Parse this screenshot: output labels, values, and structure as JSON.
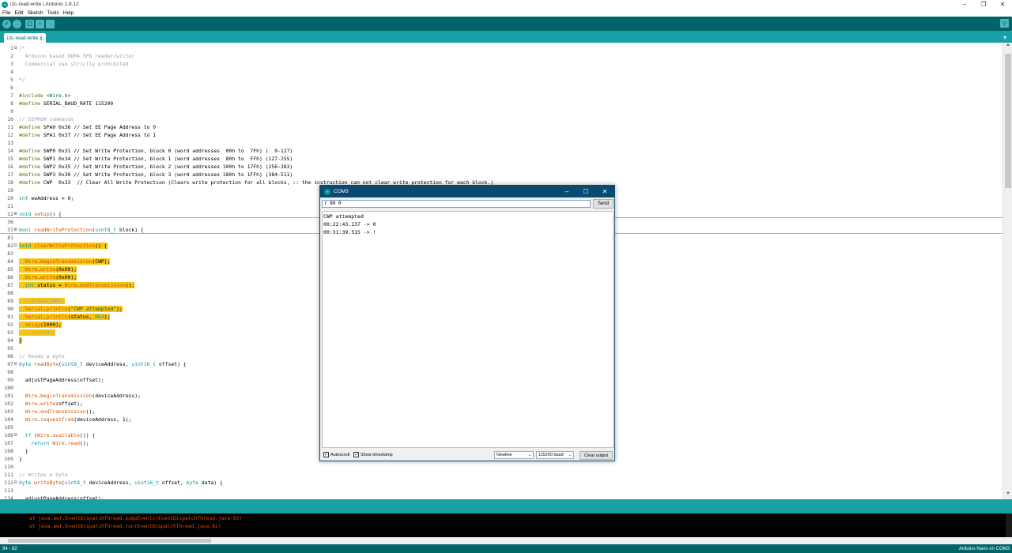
{
  "window": {
    "title": "i2c-read-write | Arduino 1.8.12",
    "minimize_icon": "minimize-icon",
    "maximize_icon": "maximize-icon",
    "close_icon": "close-icon"
  },
  "menu": [
    "File",
    "Edit",
    "Sketch",
    "Tools",
    "Help"
  ],
  "toolbar": {
    "verify_icon": "✓",
    "upload_icon": "→",
    "new_icon": "▢",
    "open_icon": "↑",
    "save_icon": "↓",
    "serial_monitor_icon": "⚲"
  },
  "tab": {
    "label": "i2c-read-write §",
    "menu_icon": "▾"
  },
  "code": {
    "lines": [
      {
        "n": "1",
        "fold": "⊟",
        "parts": [
          [
            "c-comment",
            "/*"
          ]
        ]
      },
      {
        "n": "2",
        "parts": [
          [
            "c-comment",
            "  Arduino based DDR4 SPD reader/writer"
          ]
        ]
      },
      {
        "n": "3",
        "parts": [
          [
            "c-comment",
            "  Commercial use strictly prohibited"
          ]
        ]
      },
      {
        "n": "4",
        "parts": [
          [
            "",
            ""
          ]
        ]
      },
      {
        "n": "5",
        "parts": [
          [
            "c-comment",
            "*/"
          ]
        ]
      },
      {
        "n": "6",
        "parts": [
          [
            "",
            ""
          ]
        ]
      },
      {
        "n": "7",
        "parts": [
          [
            "c-pp",
            "#include "
          ],
          [
            "c-str",
            "<Wire.h>"
          ]
        ]
      },
      {
        "n": "8",
        "parts": [
          [
            "c-pp",
            "#define "
          ],
          [
            "",
            "SERIAL_BAUD_RATE 115200"
          ]
        ]
      },
      {
        "n": "9",
        "parts": [
          [
            "",
            ""
          ]
        ]
      },
      {
        "n": "10",
        "parts": [
          [
            "c-comment",
            "// EEPROM commands"
          ]
        ]
      },
      {
        "n": "11",
        "parts": [
          [
            "c-pp",
            "#define "
          ],
          [
            "",
            "SPA0 0x36 // Set EE Page Address to 0"
          ]
        ]
      },
      {
        "n": "12",
        "parts": [
          [
            "c-pp",
            "#define "
          ],
          [
            "",
            "SPA1 0x37 // Set EE Page Address to 1"
          ]
        ]
      },
      {
        "n": "13",
        "parts": [
          [
            "",
            ""
          ]
        ]
      },
      {
        "n": "14",
        "parts": [
          [
            "c-pp",
            "#define "
          ],
          [
            "",
            "SWP0 0x31 // Set Write Protection, block 0 (word addresses  00h to  7Fh) (  0-127)"
          ]
        ]
      },
      {
        "n": "15",
        "parts": [
          [
            "c-pp",
            "#define "
          ],
          [
            "",
            "SWP1 0x34 // Set Write Protection, block 1 (word addresses  80h to  FFh) (127-255)"
          ]
        ]
      },
      {
        "n": "16",
        "parts": [
          [
            "c-pp",
            "#define "
          ],
          [
            "",
            "SWP2 0x35 // Set Write Protection, block 2 (word addresses 100h to 17Fh) (256-383)"
          ]
        ]
      },
      {
        "n": "17",
        "parts": [
          [
            "c-pp",
            "#define "
          ],
          [
            "",
            "SWP3 0x30 // Set Write Protection, block 3 (word addresses 180h to 1FFh) (384-511)"
          ]
        ]
      },
      {
        "n": "18",
        "parts": [
          [
            "c-pp",
            "#define "
          ],
          [
            "",
            "CWP  0x33  // Clear All Write Protection (Clears write protection for all blocks, :: the instruction can not clear write protection for each block.)"
          ]
        ]
      },
      {
        "n": "19",
        "parts": [
          [
            "",
            ""
          ]
        ]
      },
      {
        "n": "20",
        "parts": [
          [
            "c-kw",
            "int"
          ],
          [
            "",
            " eeAddress = 0;"
          ]
        ]
      },
      {
        "n": "21",
        "parts": [
          [
            "",
            ""
          ]
        ]
      },
      {
        "n": "22",
        "fold": "⊞",
        "parts": [
          [
            "c-kw",
            "void"
          ],
          [
            "",
            " "
          ],
          [
            "c-type",
            "setup"
          ],
          [
            "",
            "() {"
          ]
        ]
      },
      {
        "n": "36",
        "parts": [
          [
            "",
            ""
          ]
        ]
      },
      {
        "n": "37",
        "fold": "⊞",
        "parts": [
          [
            "c-kw",
            "bool"
          ],
          [
            "",
            " "
          ],
          [
            "c-type",
            "readWriteProtection"
          ],
          [
            "",
            "("
          ],
          [
            "c-kw",
            "uint8_t"
          ],
          [
            "",
            " block) {"
          ]
        ]
      },
      {
        "n": "81",
        "parts": [
          [
            "",
            ""
          ]
        ]
      },
      {
        "n": "82",
        "fold": "⊟",
        "hl": true,
        "parts": [
          [
            "c-kw",
            "void"
          ],
          [
            "",
            " "
          ],
          [
            "c-type",
            "clearWriteProtection"
          ],
          [
            "",
            "() {"
          ]
        ]
      },
      {
        "n": "83",
        "parts": [
          [
            "",
            ""
          ]
        ]
      },
      {
        "n": "84",
        "hl": true,
        "parts": [
          [
            "",
            "  "
          ],
          [
            "c-type",
            "Wire"
          ],
          [
            "",
            "."
          ],
          [
            "c-type",
            "beginTransmission"
          ],
          [
            "",
            "(CWP);"
          ]
        ]
      },
      {
        "n": "85",
        "hl": true,
        "parts": [
          [
            "",
            "  "
          ],
          [
            "c-type",
            "Wire"
          ],
          [
            "",
            "."
          ],
          [
            "c-type",
            "write"
          ],
          [
            "",
            "(0x00);"
          ]
        ]
      },
      {
        "n": "86",
        "hl": true,
        "parts": [
          [
            "",
            "  "
          ],
          [
            "c-type",
            "Wire"
          ],
          [
            "",
            "."
          ],
          [
            "c-type",
            "write"
          ],
          [
            "",
            "(0x00);"
          ]
        ]
      },
      {
        "n": "87",
        "hl": true,
        "parts": [
          [
            "",
            "  "
          ],
          [
            "c-kw",
            "int"
          ],
          [
            "",
            " status = "
          ],
          [
            "c-type",
            "Wire"
          ],
          [
            "",
            "."
          ],
          [
            "c-type",
            "endTransmission"
          ],
          [
            "",
            "();"
          ]
        ]
      },
      {
        "n": "88",
        "parts": [
          [
            "",
            ""
          ]
        ]
      },
      {
        "n": "89",
        "hl": true,
        "parts": [
          [
            "",
            "  "
          ],
          [
            "c-comment",
            "//probe(CWP);"
          ]
        ]
      },
      {
        "n": "90",
        "hl": true,
        "parts": [
          [
            "",
            "  "
          ],
          [
            "c-type",
            "Serial"
          ],
          [
            "",
            "."
          ],
          [
            "c-type",
            "println"
          ],
          [
            "",
            "("
          ],
          [
            "c-str",
            "\"CWP attempted\""
          ],
          [
            "",
            ");"
          ]
        ]
      },
      {
        "n": "91",
        "hl": true,
        "parts": [
          [
            "",
            "  "
          ],
          [
            "c-type",
            "Serial"
          ],
          [
            "",
            "."
          ],
          [
            "c-type",
            "println"
          ],
          [
            "",
            "(status, "
          ],
          [
            "c-kw",
            "HEX"
          ],
          [
            "",
            ");"
          ]
        ]
      },
      {
        "n": "92",
        "hl": true,
        "parts": [
          [
            "",
            "  "
          ],
          [
            "c-type",
            "delay"
          ],
          [
            "",
            "(1000);"
          ]
        ]
      },
      {
        "n": "93",
        "hl": true,
        "parts": [
          [
            "",
            "  "
          ],
          [
            "c-comment",
            "//exit(0);"
          ]
        ]
      },
      {
        "n": "94",
        "hl": true,
        "parts": [
          [
            "",
            "}"
          ]
        ]
      },
      {
        "n": "95",
        "parts": [
          [
            "",
            ""
          ]
        ]
      },
      {
        "n": "96",
        "parts": [
          [
            "c-comment",
            "// Reads a byte"
          ]
        ]
      },
      {
        "n": "97",
        "fold": "⊟",
        "parts": [
          [
            "c-kw",
            "byte"
          ],
          [
            "",
            " "
          ],
          [
            "c-type",
            "readByte"
          ],
          [
            "",
            "("
          ],
          [
            "c-kw",
            "uint8_t"
          ],
          [
            "",
            " deviceAddress, "
          ],
          [
            "c-kw",
            "uint16_t"
          ],
          [
            "",
            " offset) {"
          ]
        ]
      },
      {
        "n": "98",
        "parts": [
          [
            "",
            ""
          ]
        ]
      },
      {
        "n": "99",
        "parts": [
          [
            "",
            "  adjustPageAddress(offset);"
          ]
        ]
      },
      {
        "n": "100",
        "parts": [
          [
            "",
            ""
          ]
        ]
      },
      {
        "n": "101",
        "parts": [
          [
            "",
            "  "
          ],
          [
            "c-type",
            "Wire"
          ],
          [
            "",
            "."
          ],
          [
            "c-type",
            "beginTransmission"
          ],
          [
            "",
            "(deviceAddress);"
          ]
        ]
      },
      {
        "n": "102",
        "parts": [
          [
            "",
            "  "
          ],
          [
            "c-type",
            "Wire"
          ],
          [
            "",
            "."
          ],
          [
            "c-type",
            "write"
          ],
          [
            "",
            "(offset);"
          ]
        ]
      },
      {
        "n": "103",
        "parts": [
          [
            "",
            "  "
          ],
          [
            "c-type",
            "Wire"
          ],
          [
            "",
            "."
          ],
          [
            "c-type",
            "endTransmission"
          ],
          [
            "",
            "();"
          ]
        ]
      },
      {
        "n": "104",
        "parts": [
          [
            "",
            "  "
          ],
          [
            "c-type",
            "Wire"
          ],
          [
            "",
            "."
          ],
          [
            "c-type",
            "requestFrom"
          ],
          [
            "",
            "(deviceAddress, 1);"
          ]
        ]
      },
      {
        "n": "105",
        "parts": [
          [
            "",
            ""
          ]
        ]
      },
      {
        "n": "106",
        "fold": "⊟",
        "parts": [
          [
            "",
            "  "
          ],
          [
            "c-kw",
            "if"
          ],
          [
            "",
            " ("
          ],
          [
            "c-type",
            "Wire"
          ],
          [
            "",
            "."
          ],
          [
            "c-type",
            "available"
          ],
          [
            "",
            "()) {"
          ]
        ]
      },
      {
        "n": "107",
        "parts": [
          [
            "",
            "    "
          ],
          [
            "c-kw",
            "return"
          ],
          [
            "",
            " "
          ],
          [
            "c-type",
            "Wire"
          ],
          [
            "",
            "."
          ],
          [
            "c-type",
            "read"
          ],
          [
            "",
            "();"
          ]
        ]
      },
      {
        "n": "108",
        "parts": [
          [
            "",
            "  }"
          ]
        ]
      },
      {
        "n": "109",
        "parts": [
          [
            "",
            "}"
          ]
        ]
      },
      {
        "n": "110",
        "parts": [
          [
            "",
            ""
          ]
        ]
      },
      {
        "n": "111",
        "parts": [
          [
            "c-comment",
            "// Writes a byte"
          ]
        ]
      },
      {
        "n": "112",
        "fold": "⊟",
        "parts": [
          [
            "c-kw",
            "byte"
          ],
          [
            "",
            " "
          ],
          [
            "c-type",
            "writeByte"
          ],
          [
            "",
            "("
          ],
          [
            "c-kw",
            "uint8_t"
          ],
          [
            "",
            " deviceAddress, "
          ],
          [
            "c-kw",
            "uint16_t"
          ],
          [
            "",
            " offset, "
          ],
          [
            "c-kw",
            "byte"
          ],
          [
            "",
            " data) {"
          ]
        ]
      },
      {
        "n": "113",
        "parts": [
          [
            "",
            ""
          ]
        ]
      },
      {
        "n": "114",
        "parts": [
          [
            "",
            "  adjustPageAddress(offset);"
          ]
        ]
      },
      {
        "n": "115",
        "parts": [
          [
            "",
            ""
          ]
        ]
      }
    ]
  },
  "console": {
    "lines": [
      "at java.awt.EventDispatchThread.pumpEvents(EventDispatchThread.java:93)",
      "at java.awt.EventDispatchThread.run(EventDispatchThread.java:82)"
    ]
  },
  "status": {
    "left": "94 - 82",
    "right": "Arduino Nano on COM3"
  },
  "serial": {
    "title": "COM3",
    "input_value": "r 80 0",
    "send_label": "Send",
    "output": [
      "CWP attempted",
      "00:22:43.137 -> 0",
      "00:31:39.515 -> !"
    ],
    "autoscroll_label": "Autoscroll",
    "timestamp_label": "Show timestamp",
    "line_ending": "Newline",
    "baud": "115200 baud",
    "clear_label": "Clear output"
  }
}
